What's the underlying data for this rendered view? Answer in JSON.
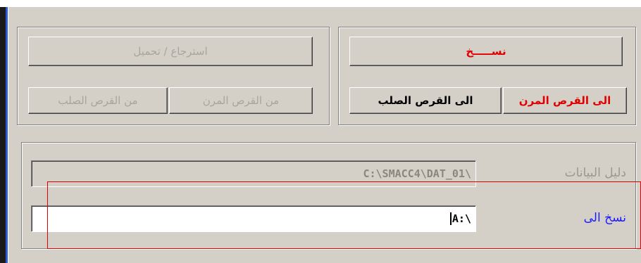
{
  "copy_group": {
    "title": "نســـــخ",
    "to_floppy": "الى القرص المرن",
    "to_hard_disk": "الى القرص الصلب"
  },
  "restore_group": {
    "title": "استرجاع / تحميل",
    "from_floppy": "من القرص المرن",
    "from_hard_disk": "من القرص الصلب"
  },
  "path_group": {
    "data_dir_label": "دليل البيانات",
    "data_dir_value": "C:\\SMACC4\\DAT_01\\",
    "copy_to_label": "نسخ الى",
    "copy_to_value": "A:\\"
  },
  "colors": {
    "face": "#d4d0c8",
    "active_red": "#e00000",
    "label_blue": "#1a1aff",
    "disabled_text": "#a8a59e",
    "highlight_rect": "#e00000"
  }
}
